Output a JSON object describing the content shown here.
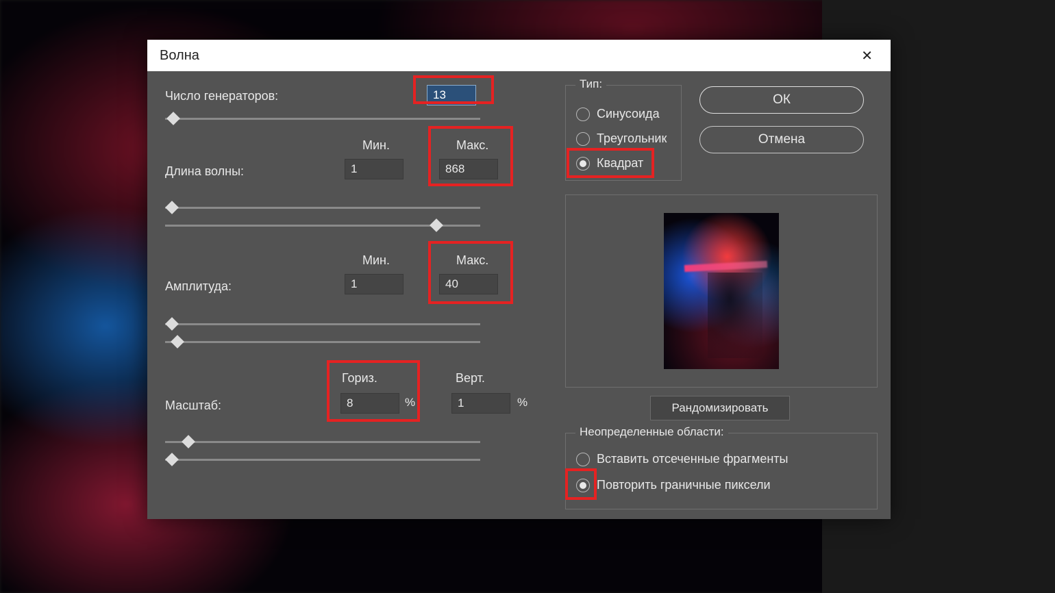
{
  "dialog": {
    "title": "Волна",
    "generators_label": "Число генераторов:",
    "generators_value": "13",
    "wavelength_label": "Длина волны:",
    "min_label": "Мин.",
    "max_label": "Макс.",
    "wavelength_min": "1",
    "wavelength_max": "868",
    "amplitude_label": "Амплитуда:",
    "amplitude_min": "1",
    "amplitude_max": "40",
    "scale_label": "Масштаб:",
    "horiz_label": "Гориз.",
    "vert_label": "Верт.",
    "scale_horiz": "8",
    "scale_vert": "1",
    "percent": "%",
    "type_group": "Тип:",
    "type_options": {
      "sine": "Синусоида",
      "triangle": "Треугольник",
      "square": "Квадрат"
    },
    "type_selected": "square",
    "ok": "ОК",
    "cancel": "Отмена",
    "randomize": "Рандомизировать",
    "undefined_group": "Неопределенные области:",
    "undefined_options": {
      "wrap": "Вставить отсеченные фрагменты",
      "repeat": "Повторить граничные пиксели"
    },
    "undefined_selected": "repeat"
  }
}
